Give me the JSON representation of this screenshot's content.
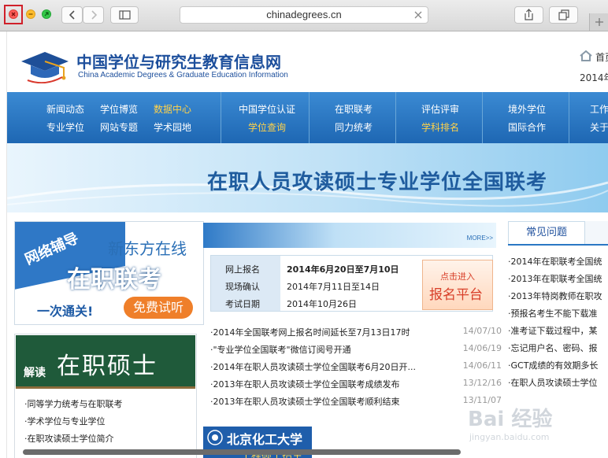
{
  "browser": {
    "url": "chinadegrees.cn"
  },
  "header": {
    "title_cn": "中国学位与研究生教育信息网",
    "title_en": "China Academic Degrees & Graduate Education Information",
    "home_link": "首页",
    "year_text": "2014年"
  },
  "nav": {
    "row1": [
      "新闻动态",
      "学位博览",
      "数据中心",
      "中国学位认证",
      "在职联考",
      "评估评审",
      "境外学位",
      "工作"
    ],
    "row2": [
      "专业学位",
      "网站专题",
      "学术园地",
      "学位查询",
      "同力统考",
      "学科排名",
      "国际合作",
      "关于"
    ]
  },
  "banner": {
    "text": "在职人员攻读硕士专业学位全国联考"
  },
  "ad1": {
    "tag": "网络辅导",
    "brand": "新东方在线",
    "title": "在职联考",
    "slogan": "一次通关!",
    "button": "免费试听"
  },
  "ad2": {
    "label": "解读",
    "title": "在职硕士",
    "links": [
      "·同等学力统考与在职联考",
      "·学术学位与专业学位",
      "·在职攻读硕士学位简介"
    ]
  },
  "center": {
    "more": "MORE>>",
    "schedule": [
      {
        "label": "网上报名",
        "value": "2014年6月20日至7月10日"
      },
      {
        "label": "现场确认",
        "value": "2014年7月11日至14日"
      },
      {
        "label": "考试日期",
        "value": "2014年10月26日"
      }
    ],
    "entry_small": "点击进入",
    "entry_big": "报名平台",
    "news": [
      {
        "title": "·2014年全国联考网上报名时间延长至7月13日17时",
        "date": "14/07/10"
      },
      {
        "title": "·\"专业学位全国联考\"微信订阅号开通",
        "date": "14/06/19"
      },
      {
        "title": "·2014年在职人员攻读硕士学位全国联考6月20日开...",
        "date": "14/06/11"
      },
      {
        "title": "·2013年在职人员攻读硕士学位全国联考成绩发布",
        "date": "13/12/16"
      },
      {
        "title": "·2013年在职人员攻读硕士学位全国联考顺利结束",
        "date": "13/11/07"
      }
    ],
    "bottom_ad_title": "北京化工大学",
    "bottom_ad_sub": "工程硕士招生"
  },
  "faq": {
    "tab": "常见问题",
    "items": [
      "·2014年在职联考全国统",
      "·2013年在职联考全国统",
      "·2013年特岗教师在职攻",
      "·预报名考生不能下载准",
      "·准考证下载过程中，某",
      "·忘记用户名、密码、报",
      "·GCT成绩的有效期多长",
      "·在职人员攻读硕士学位"
    ]
  },
  "watermark": {
    "main": "Bai 经验",
    "url": "jingyan.baidu.com"
  },
  "colors": {
    "nav_blue": "#2a78c4",
    "highlight": "#ffd24a",
    "title_blue": "#1d4f9c",
    "accent_red": "#e8462f"
  }
}
